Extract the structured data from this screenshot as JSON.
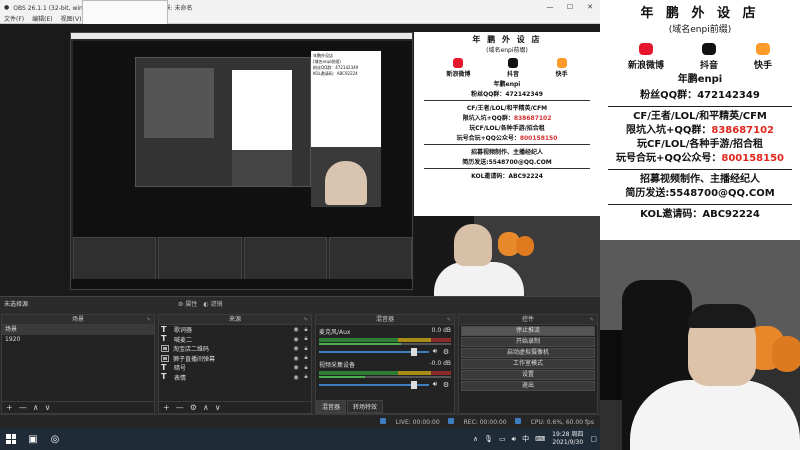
{
  "window": {
    "title": "OBS 26.1.1 (32-bit, windows) - 配置文件: 未命名 - 场景: 未命名",
    "minimize": "—",
    "maximize": "☐",
    "close": "✕"
  },
  "menu": [
    "文件(F)",
    "编辑(E)",
    "视图(V)"
  ],
  "poster": {
    "title": "年 鹏 外 设 店",
    "subtitle": "(域名enpi前缀)",
    "icons": [
      {
        "label": "新浪微博",
        "icon": "weibo-icon",
        "color": "#e6162d"
      },
      {
        "label": "抖音",
        "icon": "douyin-icon",
        "color": "#111111"
      },
      {
        "label": "快手",
        "icon": "kuaishou-icon",
        "color": "#ff9b2a"
      }
    ],
    "handle": "年鹏enpi",
    "fans_label": "粉丝QQ群：",
    "fans_value": "472142349",
    "line1": "CF/王者/LOL/和平精英/CFM",
    "line2_label": "限坑入坑+QQ群：",
    "line2_value": "838687102",
    "line3": "玩CF/LOL/各种手游/招合租",
    "line4_label": "玩号合玩+QQ公众号：",
    "line4_value": "800158150",
    "line5": "招募视频制作、主播经纪人",
    "line6": "简历发送:5548700@QQ.COM",
    "line7": "KOL邀请码：ABC92224"
  },
  "srcbar": {
    "label": "未选择源",
    "props": "属性",
    "filters": "滤镜"
  },
  "scenes": {
    "header": "场景",
    "items": [
      "场景",
      "1920"
    ]
  },
  "sources": {
    "header": "来源",
    "items": [
      {
        "type": "text",
        "label": "歌词器"
      },
      {
        "type": "text",
        "label": "喊麦二"
      },
      {
        "type": "image",
        "label": "淘宝店二维码"
      },
      {
        "type": "image",
        "label": "狮子直播间弹幕"
      },
      {
        "type": "text",
        "label": "暗号"
      },
      {
        "type": "text",
        "label": "表情"
      }
    ]
  },
  "mixer": {
    "header": "混音器",
    "channels": [
      {
        "name": "麦克风/Aux",
        "db": "0.0 dB",
        "level": 0.62
      },
      {
        "name": "视频采集设备",
        "db": "-0.0 dB",
        "level": 0.35
      }
    ],
    "tab_mixer": "混音器",
    "tab_transition": "转场特效"
  },
  "controls": {
    "header": "控件",
    "buttons": [
      "停止推流",
      "开始录制",
      "启动虚拟摄像机",
      "工作室模式",
      "设置",
      "退出"
    ]
  },
  "status": {
    "live": "LIVE: 00:00:00",
    "rec": "REC: 00:00:00",
    "cpu": "CPU: 0.6%, 60.00 fps"
  },
  "taskbar": {
    "ime": "中",
    "time": "19:28 周四",
    "date": "2021/9/30"
  },
  "nested": {
    "title": "年鹏外设店",
    "sub": "(域名enpi前缀)",
    "fans": "粉丝QQ群：472142349",
    "kol": "KOL邀请码：ABC92224"
  }
}
